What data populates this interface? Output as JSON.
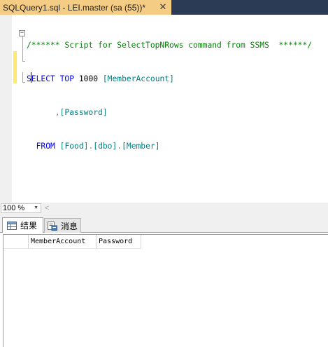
{
  "tab": {
    "title": "SQLQuery1.sql - LEI.master (sa (55))*",
    "close_glyph": "✕"
  },
  "editor": {
    "comment": "/****** Script for SelectTopNRows command from SSMS  ******/",
    "line2": {
      "kw_select": "SELECT",
      "kw_top": "TOP",
      "count": "1000",
      "col": "[MemberAccount]"
    },
    "line3": {
      "comma": ",",
      "col": "[Password]"
    },
    "line4": {
      "kw_from": "FROM",
      "db": "[Food]",
      "dot1": ".",
      "schema": "[dbo]",
      "dot2": ".",
      "table": "[Member]"
    },
    "fold_glyph": "−"
  },
  "zoom": {
    "value": "100 %",
    "arrow_glyph": "▼",
    "scroll_left_glyph": "<"
  },
  "results_tabs": [
    {
      "label": "结果",
      "icon": "grid-icon",
      "active": true
    },
    {
      "label": "消息",
      "icon": "messages-icon",
      "active": false
    }
  ],
  "grid": {
    "columns": [
      "MemberAccount",
      "Password"
    ]
  },
  "colors": {
    "tab_active": "#f5cc84",
    "tab_bar": "#2b3a55",
    "comment": "#008000",
    "keyword": "#0000ff",
    "identifier": "#008080",
    "change_marker": "#fde96b"
  }
}
